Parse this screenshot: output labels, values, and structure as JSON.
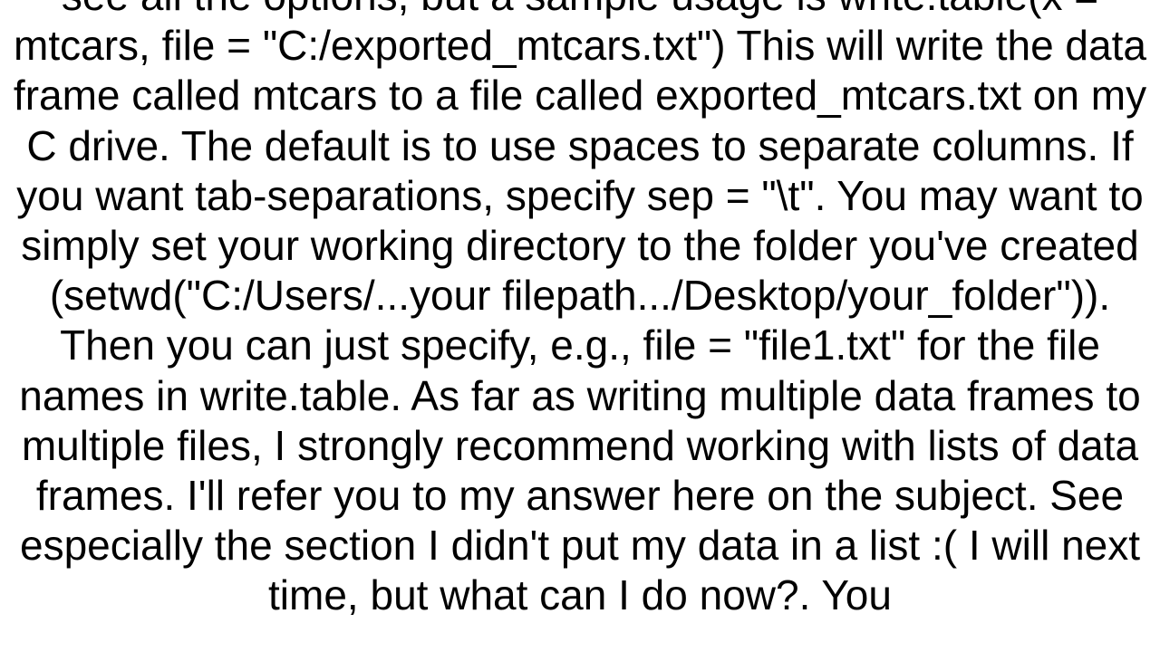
{
  "document": {
    "body_text": "see all the options, but a sample usage is write.table(x = mtcars, file = \"C:/exported_mtcars.txt\")  This will write the data frame called mtcars to a file called exported_mtcars.txt on my C drive. The default is to use spaces to separate columns. If you want tab-separations, specify sep = \"\\t\". You may want to simply set your working directory to the folder you've created (setwd(\"C:/Users/...your filepath.../Desktop/your_folder\")). Then you can just specify, e.g., file = \"file1.txt\" for the file names in write.table. As far as writing multiple data frames to multiple files, I strongly recommend working with lists of data frames. I'll refer you to my answer here on the subject. See especially the section I didn't put my data in a list :( I will next time, but what can I do now?. You"
  }
}
